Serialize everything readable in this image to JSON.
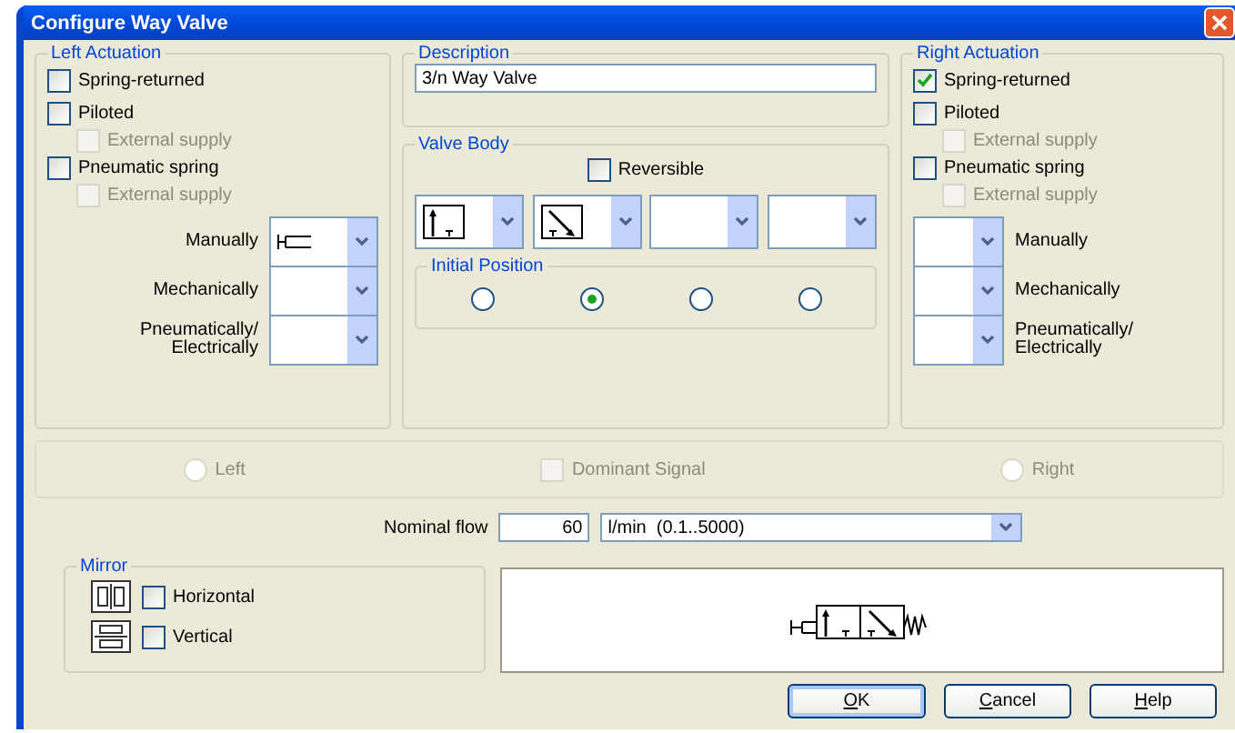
{
  "window": {
    "title": "Configure Way Valve"
  },
  "left_actuation": {
    "title": "Left Actuation",
    "options": [
      {
        "label": "Spring-returned",
        "checked": false,
        "disabled": false
      },
      {
        "label": "Piloted",
        "checked": false,
        "disabled": false,
        "children": [
          {
            "label": "External supply",
            "checked": false,
            "disabled": true
          }
        ]
      },
      {
        "label": "Pneumatic spring",
        "checked": false,
        "disabled": false,
        "children": [
          {
            "label": "External supply",
            "checked": false,
            "disabled": true
          }
        ]
      }
    ],
    "selectors": [
      {
        "label": "Manually",
        "kind": "pushbutton"
      },
      {
        "label": "Mechanically",
        "kind": "empty"
      },
      {
        "label": "Pneumatically/ Electrically",
        "kind": "empty"
      }
    ]
  },
  "description": {
    "title": "Description",
    "value": "3/n Way Valve"
  },
  "valve_body": {
    "title": "Valve Body",
    "reversible": {
      "label": "Reversible",
      "checked": false
    },
    "positions": [
      {
        "kind": "straight"
      },
      {
        "kind": "cross"
      },
      {
        "kind": "empty"
      },
      {
        "kind": "empty"
      }
    ],
    "initial_position": {
      "title": "Initial Position",
      "options": [
        {
          "selected": false
        },
        {
          "selected": true
        },
        {
          "selected": false
        },
        {
          "selected": false
        }
      ]
    }
  },
  "right_actuation": {
    "title": "Right Actuation",
    "options": [
      {
        "label": "Spring-returned",
        "checked": true,
        "disabled": false
      },
      {
        "label": "Piloted",
        "checked": false,
        "disabled": false,
        "children": [
          {
            "label": "External supply",
            "checked": false,
            "disabled": true
          }
        ]
      },
      {
        "label": "Pneumatic spring",
        "checked": false,
        "disabled": false,
        "children": [
          {
            "label": "External supply",
            "checked": false,
            "disabled": true
          }
        ]
      }
    ],
    "selectors": [
      {
        "label": "Manually",
        "kind": "empty"
      },
      {
        "label": "Mechanically",
        "kind": "empty"
      },
      {
        "label": "Pneumatically/ Electrically",
        "kind": "empty"
      }
    ]
  },
  "signal": [
    {
      "kind": "radio",
      "label": "Left",
      "selected": false,
      "disabled": true
    },
    {
      "kind": "checkbox",
      "label": "Dominant Signal",
      "checked": false,
      "disabled": true
    },
    {
      "kind": "radio",
      "label": "Right",
      "selected": false,
      "disabled": true
    }
  ],
  "nominal_flow": {
    "label": "Nominal flow",
    "value": "60",
    "unit": "l/min  (0.1..5000)"
  },
  "mirror": {
    "title": "Mirror",
    "options": [
      {
        "kind": "horizontal",
        "label": "Horizontal",
        "checked": false
      },
      {
        "kind": "vertical",
        "label": "Vertical",
        "checked": false
      }
    ]
  },
  "buttons": [
    {
      "label": "OK",
      "default": true
    },
    {
      "label": "Cancel",
      "default": false
    },
    {
      "label": "Help",
      "default": false
    }
  ]
}
